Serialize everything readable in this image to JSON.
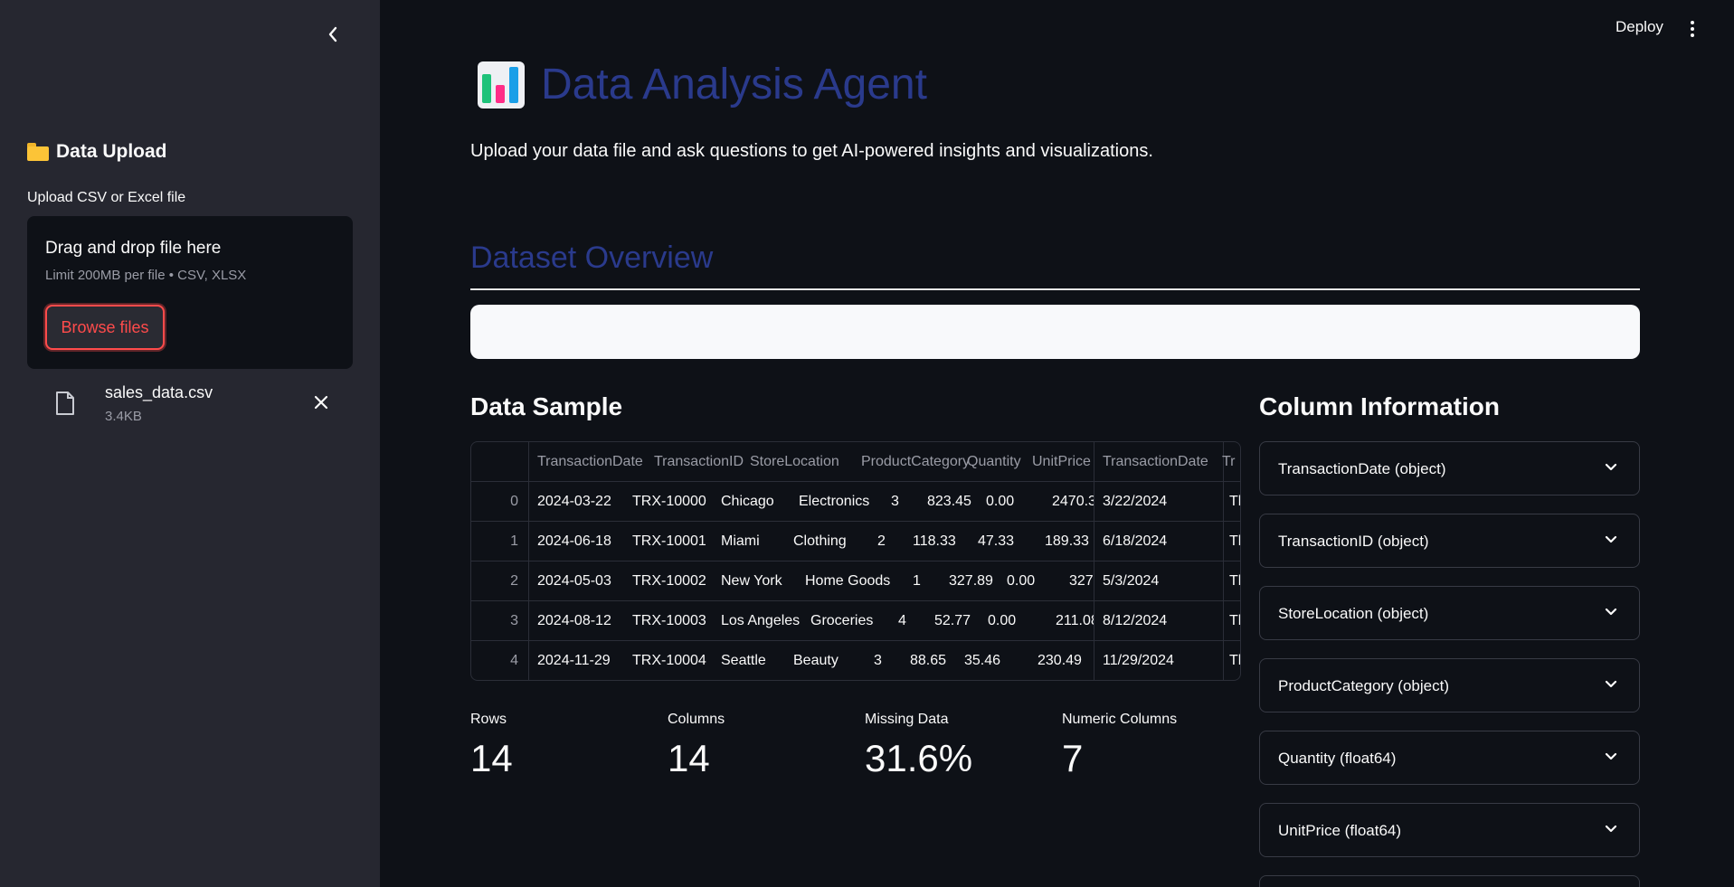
{
  "sidebar": {
    "header": "Data Upload",
    "upload_label": "Upload CSV or Excel file",
    "dropzone": {
      "title": "Drag and drop file here",
      "limit": "Limit 200MB per file • CSV, XLSX",
      "browse_label": "Browse files"
    },
    "file": {
      "name": "sales_data.csv",
      "size": "3.4KB"
    }
  },
  "header": {
    "deploy_label": "Deploy"
  },
  "main": {
    "title": "Data Analysis Agent",
    "subtitle": "Upload your data file and ask questions to get AI-powered insights and visualizations.",
    "section_title": "Dataset Overview",
    "data_sample_title": "Data Sample",
    "column_info_title": "Column Information"
  },
  "table": {
    "columns": [
      "TransactionDate",
      "TransactionID",
      "StoreLocation",
      "ProductCategory",
      "Quantity",
      "UnitPrice",
      "TransactionDate",
      "Tr"
    ],
    "rows": [
      {
        "idx": "0",
        "cells": [
          "2024-03-22",
          "TRX-10000",
          "Chicago",
          "Electronics",
          "3",
          "823.45",
          "0.00",
          "2470.3",
          "3/22/2024",
          "Th"
        ]
      },
      {
        "idx": "1",
        "cells": [
          "2024-06-18",
          "TRX-10001",
          "Miami",
          "Clothing",
          "2",
          "118.33",
          "47.33",
          "189.33",
          "6/18/2024",
          "Th"
        ]
      },
      {
        "idx": "2",
        "cells": [
          "2024-05-03",
          "TRX-10002",
          "New York",
          "Home Goods",
          "1",
          "327.89",
          "0.00",
          "327",
          "5/3/2024",
          "Th"
        ]
      },
      {
        "idx": "3",
        "cells": [
          "2024-08-12",
          "TRX-10003",
          "Los Angeles",
          "Groceries",
          "4",
          "52.77",
          "0.00",
          "211.08",
          "8/12/2024",
          "Th"
        ]
      },
      {
        "idx": "4",
        "cells": [
          "2024-11-29",
          "TRX-10004",
          "Seattle",
          "Beauty",
          "3",
          "88.65",
          "35.46",
          "230.49",
          "11/29/2024",
          "Th"
        ]
      }
    ]
  },
  "metrics": [
    {
      "label": "Rows",
      "value": "14"
    },
    {
      "label": "Columns",
      "value": "14"
    },
    {
      "label": "Missing Data",
      "value": "31.6%"
    },
    {
      "label": "Numeric Columns",
      "value": "7"
    }
  ],
  "column_info": [
    "TransactionDate (object)",
    "TransactionID (object)",
    "StoreLocation (object)",
    "ProductCategory (object)",
    "Quantity (float64)",
    "UnitPrice (float64)"
  ],
  "colors": {
    "accent": "#ff4b4b",
    "title_blue": "#2a3a8c",
    "background": "#0e1117",
    "sidebar": "#262730"
  }
}
